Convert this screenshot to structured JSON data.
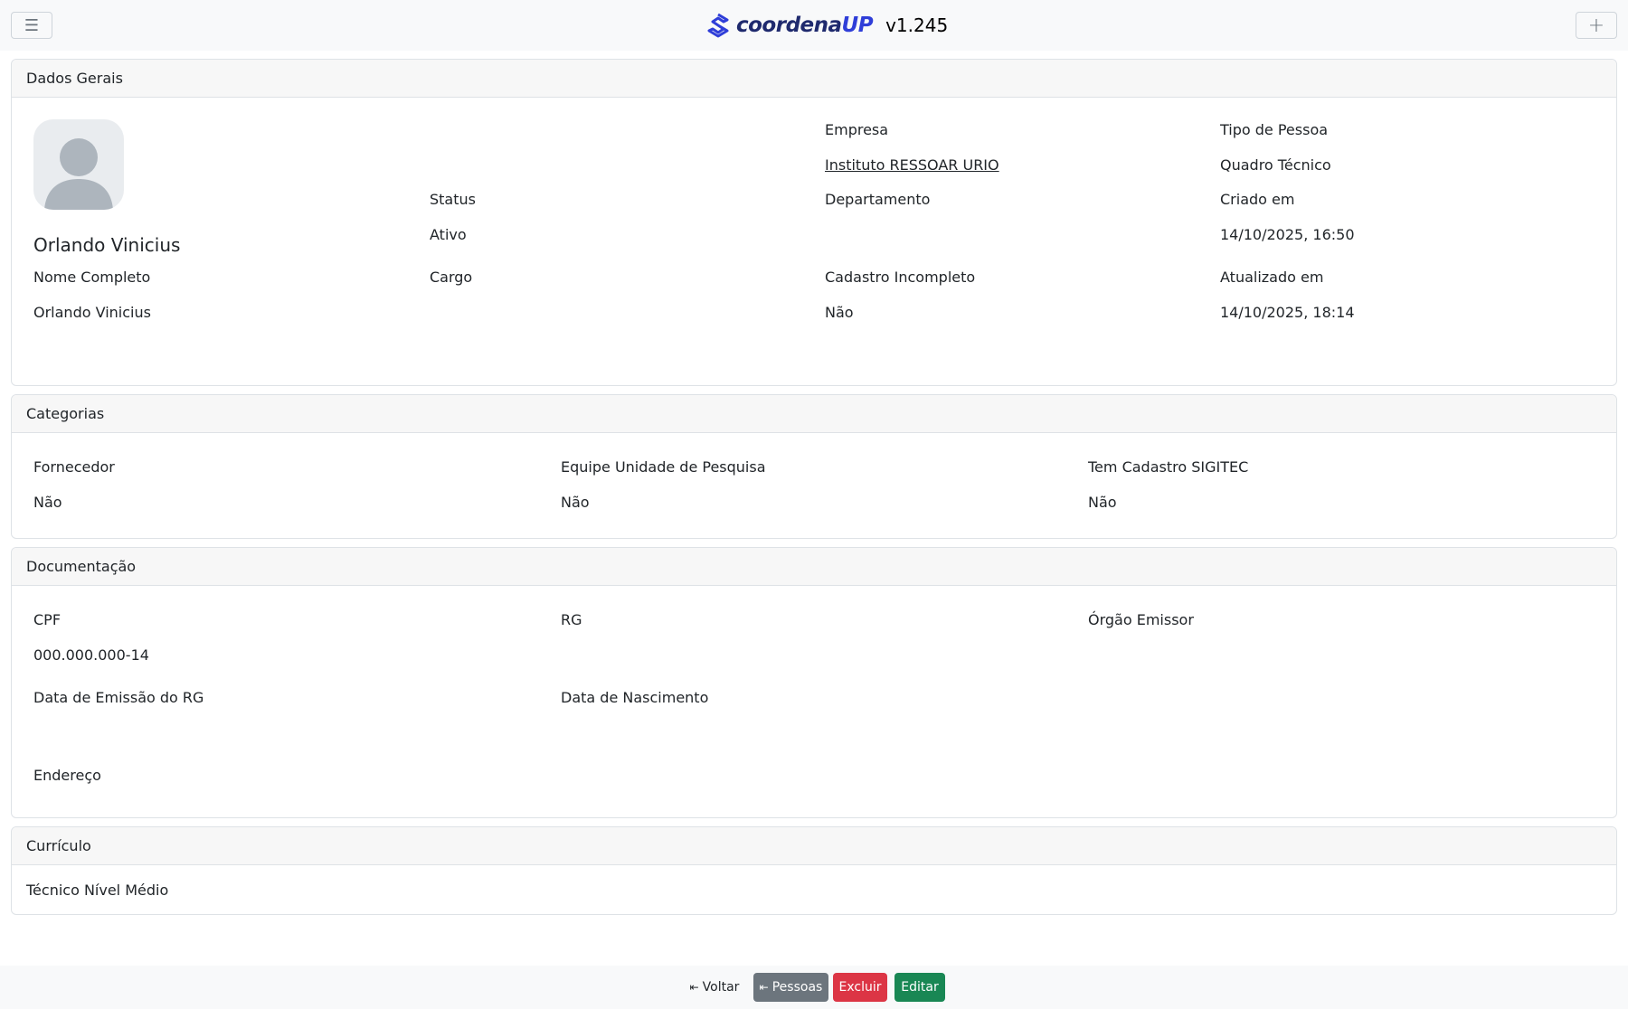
{
  "header": {
    "brand_name_a": "coordena",
    "brand_name_b": "UP",
    "version": "v1.245"
  },
  "dados_gerais": {
    "title": "Dados Gerais",
    "person_name": "Orlando Vinicius",
    "empresa_label": "Empresa",
    "empresa_value": "Instituto RESSOAR URIO",
    "tipo_label": "Tipo de Pessoa",
    "tipo_value": "Quadro Técnico",
    "status_label": "Status",
    "status_value": "Ativo",
    "departamento_label": "Departamento",
    "departamento_value": "",
    "criado_label": "Criado em",
    "criado_value": "14/10/2025, 16:50",
    "nome_label": "Nome Completo",
    "nome_value": "Orlando Vinicius",
    "cargo_label": "Cargo",
    "cargo_value": "",
    "incompleto_label": "Cadastro Incompleto",
    "incompleto_value": "Não",
    "atualizado_label": "Atualizado em",
    "atualizado_value": "14/10/2025, 18:14"
  },
  "categorias": {
    "title": "Categorias",
    "fornecedor_label": "Fornecedor",
    "fornecedor_value": "Não",
    "equipe_label": "Equipe Unidade de Pesquisa",
    "equipe_value": "Não",
    "sigitec_label": "Tem Cadastro SIGITEC",
    "sigitec_value": "Não"
  },
  "documentacao": {
    "title": "Documentação",
    "cpf_label": "CPF",
    "cpf_value": "000.000.000-14",
    "rg_label": "RG",
    "rg_value": "",
    "orgao_label": "Órgão Emissor",
    "orgao_value": "",
    "emissao_label": "Data de Emissão do RG",
    "emissao_value": "",
    "nascimento_label": "Data de Nascimento",
    "nascimento_value": "",
    "endereco_label": "Endereço"
  },
  "curriculo": {
    "title": "Currículo",
    "value": "Técnico Nível Médio"
  },
  "footer": {
    "back_label": "Voltar",
    "pessoas_label": "Pessoas",
    "excluir_label": "Excluir",
    "editar_label": "Editar"
  },
  "colors": {
    "brand_dark": "#1f2a6e",
    "brand_blue": "#2f3ed8",
    "secondary": "#6c757d",
    "danger": "#dc3545",
    "success": "#198754"
  }
}
